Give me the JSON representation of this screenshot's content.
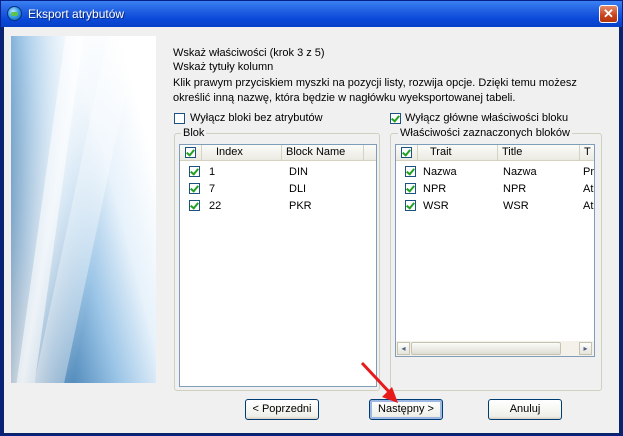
{
  "window": {
    "title": "Eksport atrybutów",
    "close_glyph": "✕"
  },
  "intro": {
    "step_title": "Wskaż właściwości (krok 3 z 5)",
    "subtitle": "Wskaż tytuły kolumn",
    "description_line1": "Klik prawym przyciskiem myszki na pozycji listy, rozwija opcje. Dzięki temu możesz",
    "description_line2": "określić inną nazwę, która będzie w nagłówku wyeksportowanej tabeli."
  },
  "options": {
    "hide_blocks_without_attributes": {
      "label": "Wyłącz bloki bez atrybutów",
      "checked": false
    },
    "hide_main_block_properties": {
      "label": "Wyłącz główne właściwości bloku",
      "checked": true
    }
  },
  "block_group": {
    "label": "Blok",
    "columns": [
      "Index",
      "Block Name"
    ],
    "rows": [
      {
        "index": "1",
        "name": "DIN",
        "checked": true
      },
      {
        "index": "7",
        "name": "DLI",
        "checked": true
      },
      {
        "index": "22",
        "name": "PKR",
        "checked": true
      }
    ]
  },
  "props_group": {
    "label": "Właściwości zaznaczonych bloków",
    "columns": [
      "Trait",
      "Title",
      "T"
    ],
    "rows": [
      {
        "trait": "Nazwa",
        "title": "Nazwa",
        "third": "Pr",
        "checked": true
      },
      {
        "trait": "NPR",
        "title": "NPR",
        "third": "At",
        "checked": true
      },
      {
        "trait": "WSR",
        "title": "WSR",
        "third": "At",
        "checked": true
      }
    ],
    "scroll_left_glyph": "◂",
    "scroll_right_glyph": "▸"
  },
  "buttons": {
    "back": "< Poprzedni",
    "next": "Następny >",
    "cancel": "Anuluj"
  },
  "colors": {
    "arrow": "#e8191a",
    "title_bar": "#0a48d8"
  }
}
